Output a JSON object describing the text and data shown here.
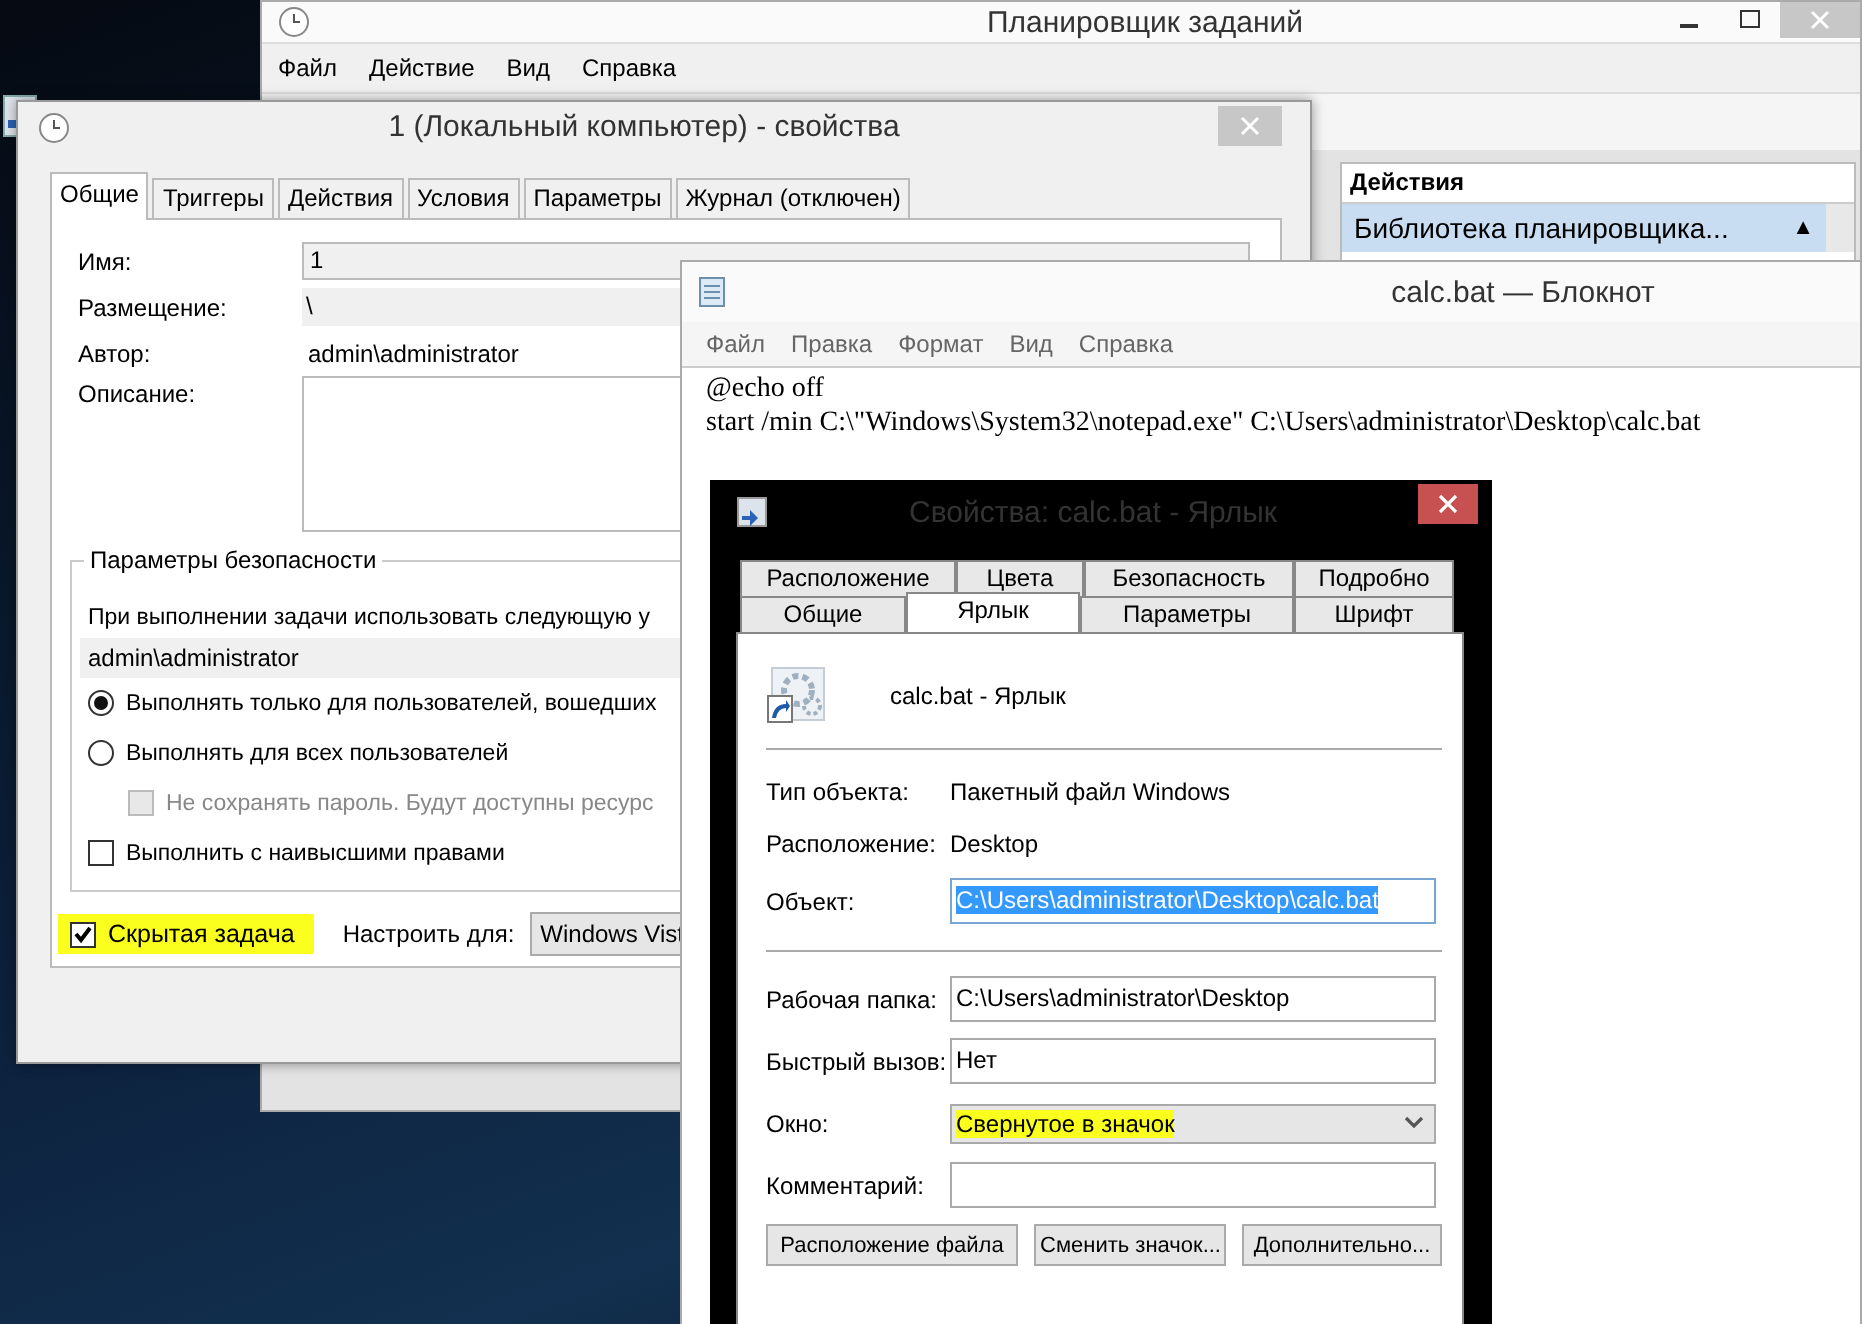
{
  "scheduler": {
    "title": "Планировщик заданий",
    "menu": [
      "Файл",
      "Действие",
      "Вид",
      "Справка"
    ],
    "actions_header": "Действия",
    "actions_item": {
      "label": "Библиотека планировщика...",
      "selected": true,
      "arrow": "▲"
    }
  },
  "properties": {
    "title": "1 (Локальный компьютер) - свойства",
    "tabs": [
      {
        "label": "Общие",
        "selected": true
      },
      {
        "label": "Триггеры",
        "selected": false
      },
      {
        "label": "Действия",
        "selected": false
      },
      {
        "label": "Условия",
        "selected": false
      },
      {
        "label": "Параметры",
        "selected": false
      },
      {
        "label": "Журнал (отключен)",
        "selected": false
      }
    ],
    "fields": [
      {
        "kind": "input",
        "label": "Имя:",
        "value": "1"
      },
      {
        "kind": "readonly",
        "label": "Размещение:",
        "value": "\\"
      },
      {
        "kind": "text",
        "label": "Автор:",
        "value": "admin\\administrator"
      },
      {
        "kind": "textarea",
        "label": "Описание:"
      }
    ],
    "security": {
      "title": "Параметры безопасности",
      "prompt": "При выполнении задачи использовать следующую у",
      "account": "admin\\administrator",
      "options": [
        {
          "kind": "radio",
          "label": "Выполнять только для пользователей, вошедших",
          "selected": true,
          "disabled": false
        },
        {
          "kind": "radio",
          "label": "Выполнять для всех пользователей",
          "selected": false,
          "disabled": false
        },
        {
          "kind": "checkbox",
          "label": "Не сохранять пароль. Будут доступны ресурс",
          "checked": false,
          "disabled": true
        },
        {
          "kind": "checkbox",
          "label": "Выполнить с наивысшими правами",
          "checked": false,
          "disabled": false
        }
      ]
    },
    "hidden": {
      "label": "Скрытая задача",
      "checked": true,
      "highlighted": true
    },
    "configure": {
      "label": "Настроить для:",
      "value": "Windows Vist"
    }
  },
  "notepad": {
    "title": "calc.bat — Блокнот",
    "menu": [
      "Файл",
      "Правка",
      "Формат",
      "Вид",
      "Справка"
    ],
    "lines": [
      "@echo off",
      "start /min C:\\\"Windows\\System32\\notepad.exe\" C:\\Users\\administrator\\Desktop\\calc.bat"
    ]
  },
  "shortcut": {
    "title": "Свойства: calc.bat - Ярлык",
    "tab_rows": [
      [
        {
          "label": "Расположение",
          "selected": false
        },
        {
          "label": "Цвета",
          "selected": false
        },
        {
          "label": "Безопасность",
          "selected": false
        },
        {
          "label": "Подробно",
          "selected": false
        }
      ],
      [
        {
          "label": "Общие",
          "selected": false
        },
        {
          "label": "Ярлык",
          "selected": true
        },
        {
          "label": "Параметры",
          "selected": false
        },
        {
          "label": "Шрифт",
          "selected": false
        }
      ]
    ],
    "name": "calc.bat - Ярлык",
    "info": [
      {
        "label": "Тип объекта:",
        "value": "Пакетный файл Windows"
      },
      {
        "label": "Расположение:",
        "value": "Desktop"
      }
    ],
    "target": {
      "label": "Объект:",
      "value": "C:\\Users\\administrator\\Desktop\\calc.bat",
      "selected": true
    },
    "fields": [
      {
        "kind": "input",
        "label": "Рабочая папка:",
        "value": "C:\\Users\\administrator\\Desktop",
        "highlighted": false
      },
      {
        "kind": "input",
        "label": "Быстрый вызов:",
        "value": "Нет",
        "highlighted": false
      },
      {
        "kind": "select",
        "label": "Окно:",
        "value": "Свернутое в значок",
        "highlighted": true
      },
      {
        "kind": "input",
        "label": "Комментарий:",
        "highlighted": false
      }
    ],
    "buttons": [
      "Расположение файла",
      "Сменить значок...",
      "Дополнительно..."
    ]
  }
}
